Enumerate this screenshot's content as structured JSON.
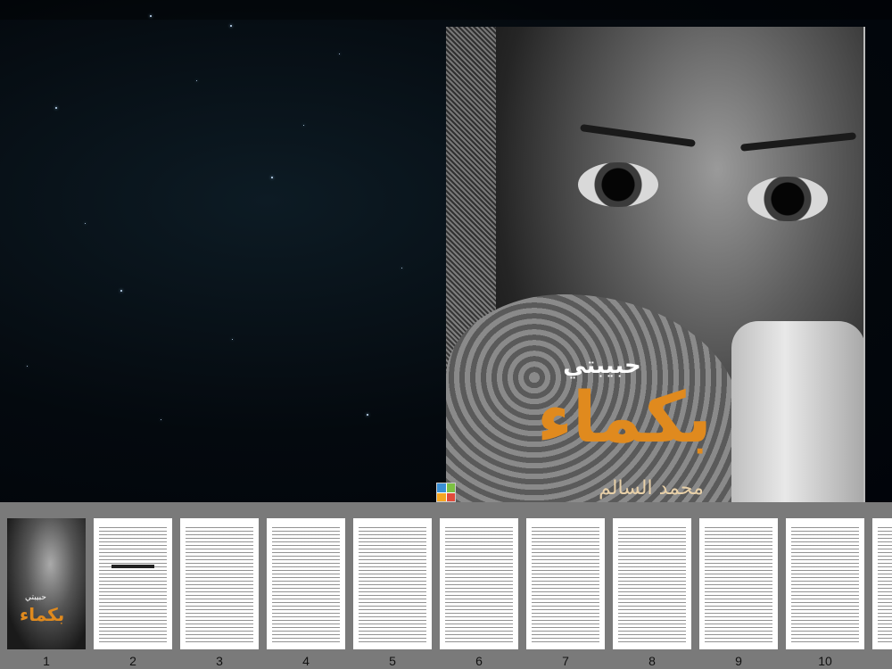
{
  "reader": {
    "cover": {
      "subtitle": "حبيبتي",
      "title": "بكماء",
      "author": "محمد السالم"
    },
    "app_icon": "reader-app-icon",
    "colors": {
      "title_orange": "#e08a1e",
      "strip_bg": "#7a7a7a"
    }
  },
  "thumbnails": [
    {
      "label": "1",
      "kind": "cover",
      "subtitle": "حبيبتي",
      "title": "بكماء"
    },
    {
      "label": "2",
      "kind": "text"
    },
    {
      "label": "3",
      "kind": "text"
    },
    {
      "label": "4",
      "kind": "text"
    },
    {
      "label": "5",
      "kind": "text"
    },
    {
      "label": "6",
      "kind": "text"
    },
    {
      "label": "7",
      "kind": "text"
    },
    {
      "label": "8",
      "kind": "text"
    },
    {
      "label": "9",
      "kind": "text"
    },
    {
      "label": "10",
      "kind": "text"
    },
    {
      "label": "",
      "kind": "text"
    }
  ]
}
